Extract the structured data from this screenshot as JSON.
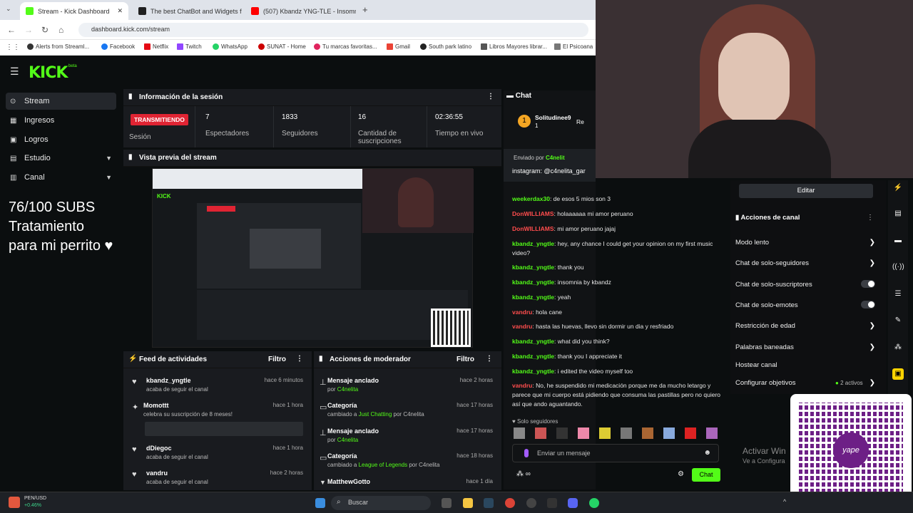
{
  "browser": {
    "tabs": [
      {
        "title": "Stream - Kick Dashboard",
        "color": "#53fc18"
      },
      {
        "title": "The best ChatBot and Widgets f",
        "color": "#202020"
      },
      {
        "title": "(507) Kbandz YNG-TLE - Insomn",
        "color": "#ff0000"
      }
    ],
    "new_tab": "+",
    "url": "dashboard.kick.com/stream",
    "bookmarks": [
      "Alerts from Streaml...",
      "Facebook",
      "Netflix",
      "Twitch",
      "WhatsApp",
      "SUNAT - Home",
      "Tu marcas favoritas...",
      "Gmail",
      "South park latino",
      "Libros Mayores librar...",
      "El Psicoana"
    ]
  },
  "app": {
    "logo": "KICK",
    "logo_sup": "beta",
    "sidebar": [
      {
        "label": "Stream",
        "icon": "stream-icon",
        "active": true
      },
      {
        "label": "Ingresos",
        "icon": "income-icon"
      },
      {
        "label": "Logros",
        "icon": "trophy-icon"
      },
      {
        "label": "Estudio",
        "icon": "studio-icon",
        "expandable": true
      },
      {
        "label": "Canal",
        "icon": "channel-icon",
        "expandable": true
      }
    ],
    "overlay_text": [
      "76/100 SUBS",
      "Tratamiento",
      "para mi perrito ♥"
    ],
    "session": {
      "title": "Información de la sesión",
      "status_badge": "TRANSMITIENDO",
      "status_label": "Sesión",
      "stats": [
        {
          "value": "7",
          "label": "Espectadores"
        },
        {
          "value": "1833",
          "label": "Seguidores"
        },
        {
          "value": "16",
          "label": "Cantidad de suscripciones"
        },
        {
          "value": "02:36:55",
          "label": "Tiempo en vivo"
        }
      ]
    },
    "preview": {
      "title": "Vista previa del stream"
    },
    "feed": {
      "title": "Feed de actividades",
      "filter": "Filtro",
      "items": [
        {
          "name": "kbandz_yngtle",
          "sub": "acaba de seguir el canal",
          "time": "hace 6 minutos",
          "icon": "heart-icon"
        },
        {
          "name": "Momottt",
          "sub": "celebra su suscripción de 8 meses!",
          "time": "hace 1 hora",
          "icon": "star-icon"
        },
        {
          "name": "dDiegoc",
          "sub": "acaba de seguir el canal",
          "time": "hace 1 hora",
          "icon": "heart-icon"
        },
        {
          "name": "vandru",
          "sub": "acaba de seguir el canal",
          "time": "hace 2 horas",
          "icon": "heart-icon"
        }
      ]
    },
    "mod_actions": {
      "title": "Acciones de moderador",
      "filter": "Filtro",
      "items": [
        {
          "name": "Mensaje anclado",
          "sub_pre": "por",
          "sub_hl": "C4nelita",
          "time": "hace 2 horas",
          "icon": "pin-icon"
        },
        {
          "name": "Categoría",
          "sub_pre": "cambiado a",
          "sub_hl": "Just Chatting",
          "sub_post": "por C4nelita",
          "time": "hace 17 horas",
          "icon": "category-icon"
        },
        {
          "name": "Mensaje anclado",
          "sub_pre": "por",
          "sub_hl": "C4nelita",
          "time": "hace 17 horas",
          "icon": "pin-icon"
        },
        {
          "name": "Categoría",
          "sub_pre": "cambiado a",
          "sub_hl": "League of Legends",
          "sub_post": "por C4nelita",
          "time": "hace 18 horas",
          "icon": "category-icon"
        },
        {
          "name": "MatthewGotto",
          "sub_pre": "",
          "sub_hl": "",
          "time": "hace 1 día",
          "icon": "chevron-down-icon"
        }
      ]
    },
    "chat": {
      "title": "Chat",
      "top_user": "Solitudinee9",
      "top_count": "1",
      "top_tag": "Re",
      "pinned_by": "Enviado por",
      "pinned_user": "C4nelit",
      "pinned_text": "instagram: @c4nelita_gar",
      "messages": [
        {
          "user": "weekerdax30",
          "text": "de esos 5 mios son 3",
          "color": "g"
        },
        {
          "user": "DonWILLIAMS",
          "text": "holaaaaaa mi amor peruano",
          "color": "r"
        },
        {
          "user": "DonWILLIAMS",
          "text": "mi amor peruano jajaj",
          "color": "r"
        },
        {
          "user": "kbandz_yngtle",
          "text": "hey, any chance I could get your opinion on my first music video?",
          "color": "g"
        },
        {
          "user": "kbandz_yngtle",
          "text": "thank you",
          "color": "g"
        },
        {
          "user": "kbandz_yngtle",
          "text": "insomnia by kbandz",
          "color": "g"
        },
        {
          "user": "kbandz_yngtle",
          "text": "yeah",
          "color": "g"
        },
        {
          "user": "vandru",
          "text": "hola cane",
          "color": "r"
        },
        {
          "user": "vandru",
          "text": "hasta las huevas, llevo sin dormir un dia y resfriado",
          "color": "r"
        },
        {
          "user": "kbandz_yngtle",
          "text": "what did you think?",
          "color": "g"
        },
        {
          "user": "kbandz_yngtle",
          "text": "thank you I appreciate it",
          "color": "g"
        },
        {
          "user": "kbandz_yngtle",
          "text": "i edited the video myself too",
          "color": "g"
        },
        {
          "user": "vandru",
          "text": "No, he suspendido mi medicación porque me da mucho letargo y parece que mi cuerpo está pidiendo que consuma las pastillas pero no quiero así que ando aguantando.",
          "color": "r"
        }
      ],
      "followers_only": "Solo seguidores",
      "input_placeholder": "Enviar un mensaje",
      "send": "Chat"
    },
    "channel_actions": {
      "edit": "Editar",
      "title": "Acciones de canal",
      "items": [
        {
          "label": "Modo lento",
          "control": "arrow"
        },
        {
          "label": "Chat de solo-seguidores",
          "control": "arrow"
        },
        {
          "label": "Chat de solo-suscriptores",
          "control": "toggle"
        },
        {
          "label": "Chat de solo-emotes",
          "control": "toggle"
        },
        {
          "label": "Restricción de edad",
          "control": "arrow"
        },
        {
          "label": "Palabras baneadas",
          "control": "arrow"
        },
        {
          "label": "Hostear canal",
          "control": "none"
        },
        {
          "label": "Configurar objetivos",
          "control": "arrow",
          "badge": "2 activos"
        }
      ]
    },
    "windows_notice": [
      "Activar Win",
      "Ve a Configura"
    ],
    "qr_brand": "yape"
  },
  "taskbar": {
    "ticker": "PEN/USD",
    "ticker_change": "+0.46%",
    "search": "Buscar"
  },
  "colors": {
    "accent": "#53fc18",
    "live": "#e02433",
    "panel": "#191b1f",
    "bg": "#0b0e0f"
  }
}
